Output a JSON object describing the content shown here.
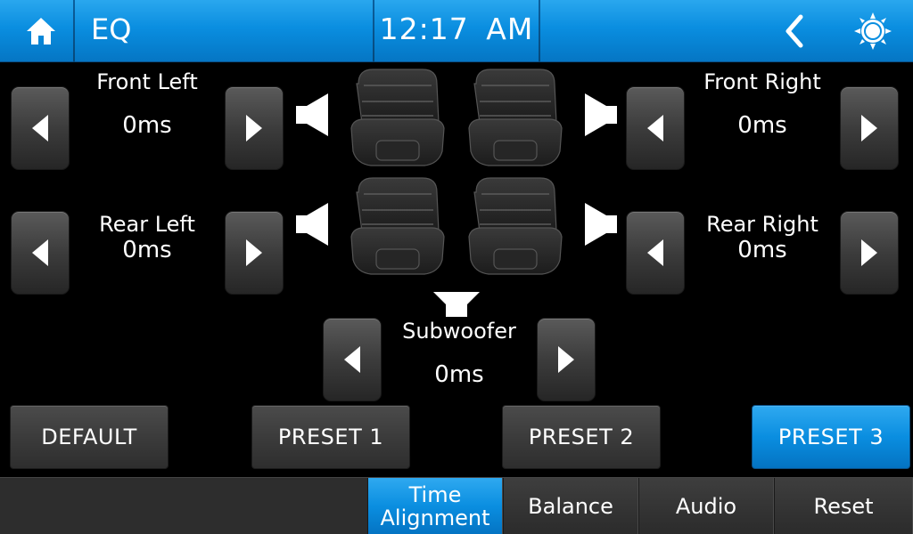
{
  "header": {
    "title": "EQ",
    "clock": "12:17  AM",
    "accent_color": "#0a8ee0",
    "icons": {
      "home": "home-icon",
      "back": "chevron-left-icon",
      "settings": "brightness-gear-icon"
    }
  },
  "channels": {
    "front_left": {
      "label": "Front Left",
      "value": "0ms"
    },
    "front_right": {
      "label": "Front Right",
      "value": "0ms"
    },
    "rear_left": {
      "label": "Rear Left",
      "value": "0ms"
    },
    "rear_right": {
      "label": "Rear Right",
      "value": "0ms"
    },
    "subwoofer": {
      "label": "Subwoofer",
      "value": "0ms"
    }
  },
  "presets": [
    {
      "label": "DEFAULT",
      "active": false
    },
    {
      "label": "PRESET 1",
      "active": false
    },
    {
      "label": "PRESET 2",
      "active": false
    },
    {
      "label": "PRESET 3",
      "active": true
    }
  ],
  "tabs": [
    {
      "label": "Time\nAlignment",
      "active": true
    },
    {
      "label": "Balance",
      "active": false
    },
    {
      "label": "Audio",
      "active": false
    },
    {
      "label": "Reset",
      "active": false
    }
  ]
}
